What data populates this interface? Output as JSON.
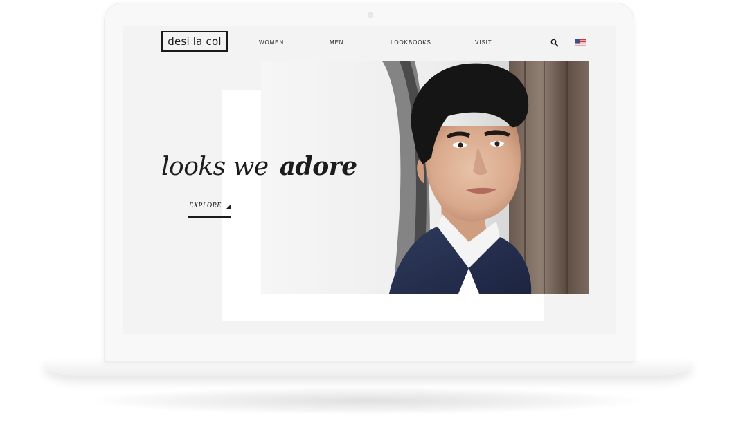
{
  "header": {
    "logo_text": "desi la col",
    "nav": [
      {
        "label": "WOMEN"
      },
      {
        "label": "MEN"
      },
      {
        "label": "LOOKBOOKS"
      },
      {
        "label": "VISIT"
      }
    ],
    "search_icon": "search-icon",
    "flag_icon": "us-flag-icon"
  },
  "hero": {
    "headline_light": "looks we",
    "headline_bold": "adore",
    "cta_label": "EXPLORE",
    "image": "portrait-photo"
  },
  "colors": {
    "screen_bg": "#f3f3f3",
    "text": "#1a1a1a",
    "panel": "#ffffff",
    "device": "#f8f8f8"
  }
}
